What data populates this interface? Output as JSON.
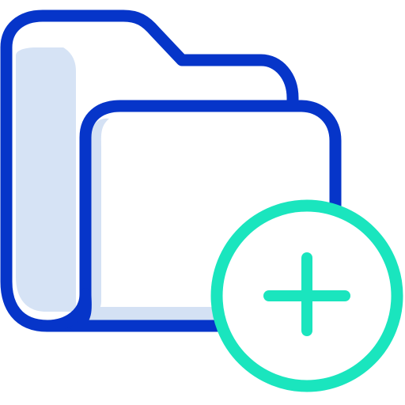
{
  "icon": {
    "name": "add-folder-icon",
    "parts": [
      "folder-icon",
      "plus-circle-icon"
    ]
  },
  "colors": {
    "outline": "#0635c9",
    "shade": "#d4e1f4",
    "fill": "#ffffff",
    "accent": "#1ae5be"
  }
}
